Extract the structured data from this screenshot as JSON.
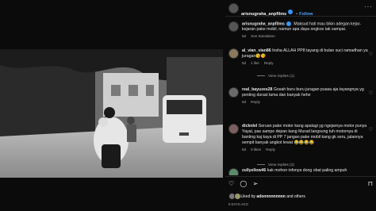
{
  "post": {
    "username": "arisnugraha_anpfilms",
    "follow_label": "Follow",
    "caption": "Maksud hati mau bikin adegan kejar-kejaran pake mobil, namun apa daya ongkos tak sampai.",
    "caption_age": "5d",
    "caption_translation": "See translation",
    "likes_prefix": "Liked by",
    "likes_user": "adonnnnnnnnn",
    "likes_suffix": "and others",
    "date": "5 DAYS AGO"
  },
  "comments": [
    {
      "user": "al_vian_vian86",
      "text": "Insha ALLAH PP8 tayang di bulan suci ramadhan ya juragan😘😘",
      "age": "5d",
      "likes": "1 like",
      "reply": "Reply",
      "view_replies": "View replies (1)"
    },
    {
      "user": "real_bayuzes28",
      "text": "Gosah buru buru juragan puasa aja tayangnya yg penting durasi lama dan banyak hehe",
      "age": "5d",
      "likes": "",
      "reply": "Reply",
      "view_replies": ""
    },
    {
      "user": "dicknlel",
      "text": "Seruan pake motor kang apalagi yg ngejarnya motor punya Yayat, pas sampe depan kang Murad langsung tuh motornya di banting kaj kaya di PP 7 jangan pake mobil kang gk seru, jalannya sempit banyak angkot lewat 😂😂😂😂",
      "age": "5d",
      "likes": "9 likes",
      "reply": "Reply",
      "view_replies": "View replies (2)"
    },
    {
      "user": "zullyellow46",
      "text": "kak mohon infonya dong obat paling ampuh",
      "age": "",
      "likes": "",
      "reply": "",
      "view_replies": ""
    }
  ],
  "icons": [
    "heart-icon",
    "comment-icon",
    "share-icon",
    "bookmark-icon",
    "more-icon"
  ]
}
